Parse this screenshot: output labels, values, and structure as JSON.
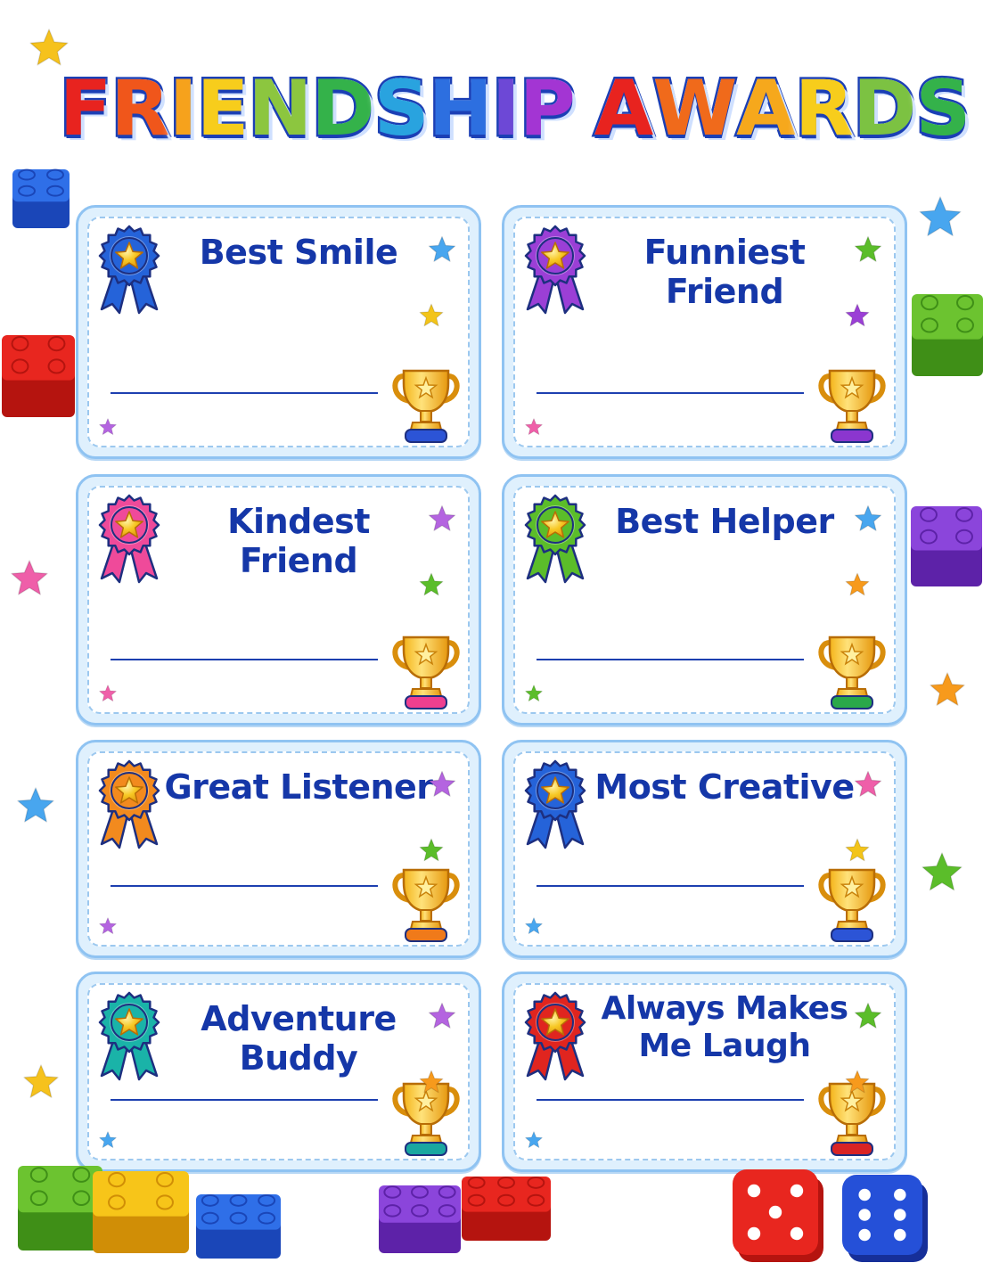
{
  "title": {
    "word1": [
      "F",
      "R",
      "I",
      "E",
      "N",
      "D",
      "S",
      "H",
      "I",
      "P"
    ],
    "word2": [
      "A",
      "W",
      "A",
      "R",
      "D",
      "S"
    ],
    "colors1": [
      "#e8231f",
      "#f0561b",
      "#f6a21c",
      "#f7cd1c",
      "#8cc63f",
      "#34b24a",
      "#29a3df",
      "#2d6fe0",
      "#6d48d6",
      "#a335d3"
    ],
    "colors2": [
      "#e8231f",
      "#f06a1b",
      "#f6a81c",
      "#f7cd1c",
      "#7cc242",
      "#34b24a"
    ]
  },
  "awards": [
    {
      "label": "Best Smile",
      "ribbon": "#2563d9",
      "trophyBase": "#2c54d6"
    },
    {
      "label": "Funniest Friend",
      "ribbon": "#9b3fd6",
      "trophyBase": "#8b36cf"
    },
    {
      "label": "Kindest Friend",
      "ribbon": "#ef4a9a",
      "trophyBase": "#ef3f8f"
    },
    {
      "label": "Best Helper",
      "ribbon": "#5bbd2a",
      "trophyBase": "#2aa84a"
    },
    {
      "label": "Great Listener",
      "ribbon": "#f28a1e",
      "trophyBase": "#f07a1a"
    },
    {
      "label": "Most Creative",
      "ribbon": "#2563d9",
      "trophyBase": "#2c54d6"
    },
    {
      "label": "Adventure Buddy",
      "ribbon": "#1ab3a8",
      "trophyBase": "#1aa7a0"
    },
    {
      "label": "Always Makes Me Laugh",
      "ribbon": "#e0251f",
      "trophyBase": "#d92424"
    }
  ],
  "colors": {
    "cardBorder": "#8fc3f2",
    "titleText": "#1537a8",
    "gold": "#f6c21c"
  }
}
